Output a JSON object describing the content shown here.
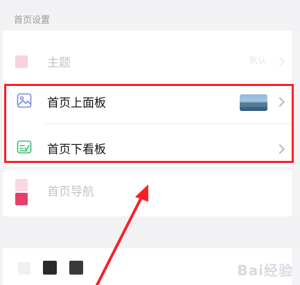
{
  "section": {
    "title": "首页设置"
  },
  "rows": {
    "theme": {
      "label": "主题",
      "value": "默认"
    },
    "top_board": {
      "label": "首页上面板"
    },
    "bottom_board": {
      "label": "首页下看板"
    },
    "nav": {
      "label": "首页导航"
    }
  },
  "colors": {
    "highlight": "#ff1d25",
    "top_icon": "#7b86d9",
    "bottom_icon": "#3cb878",
    "theme_swatch": "#e04c7a",
    "nav_swatch": "#e4406a"
  },
  "icons": {
    "top_board": "image-icon",
    "bottom_board": "board-icon",
    "chevron": "chevron-right-icon"
  },
  "watermark": "Bai经验"
}
